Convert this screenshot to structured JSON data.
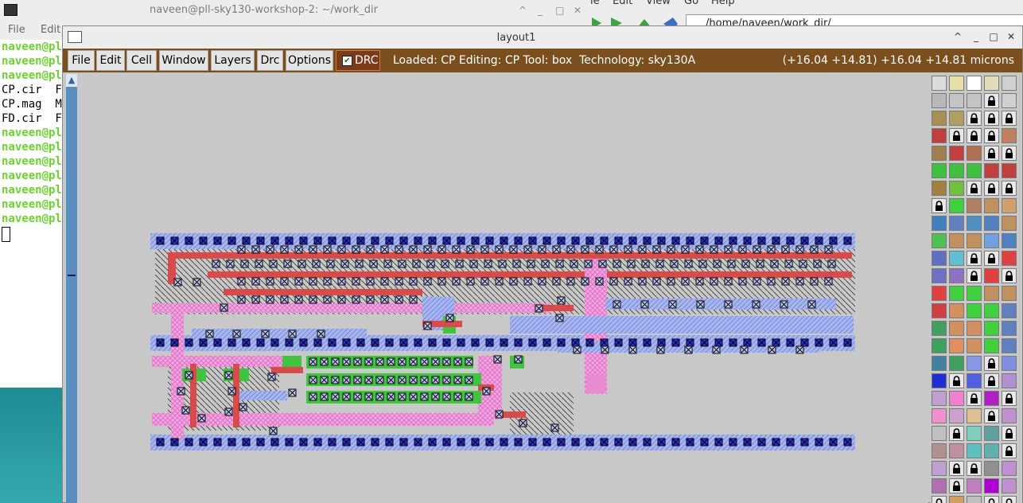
{
  "terminal": {
    "title": "naveen@pll-sky130-workshop-2: ~/work_dir",
    "menu": [
      "File",
      "Edit"
    ],
    "lines": [
      {
        "text": "naveen@pl",
        "prompt": true
      },
      {
        "text": "naveen@pl",
        "prompt": true
      },
      {
        "text": "naveen@pl",
        "prompt": true
      },
      {
        "text": "CP.cir  F",
        "prompt": false
      },
      {
        "text": "CP.mag  M",
        "prompt": false
      },
      {
        "text": "FD.cir  F",
        "prompt": false
      },
      {
        "text": "naveen@pl",
        "prompt": true
      },
      {
        "text": "naveen@pl",
        "prompt": true
      },
      {
        "text": "naveen@pl",
        "prompt": true
      },
      {
        "text": "naveen@pl",
        "prompt": true
      },
      {
        "text": "naveen@pl",
        "prompt": true
      },
      {
        "text": "naveen@pl",
        "prompt": true
      },
      {
        "text": "naveen@pl",
        "prompt": true
      }
    ]
  },
  "file_manager": {
    "menu": [
      "le",
      "Edit",
      "View",
      "Go",
      "Help"
    ],
    "path": "/home/naveen/work_dir/"
  },
  "layout_window": {
    "title": "layout1",
    "menu": [
      "File",
      "Edit",
      "Cell",
      "Window",
      "Layers",
      "Drc",
      "Options"
    ],
    "drc_label": "DRC",
    "drc_checked": true,
    "status": "Loaded: CP Editing: CP Tool: box  Technology: sky130A",
    "coordinates": "(+16.04 +14.81) +16.04 +14.81 microns"
  },
  "colors": {
    "menubar": "#7b4e1d",
    "metal1": "#8f9bff",
    "poly": "#d94a4a",
    "diffusion": "#3fc43f",
    "li": "#e88ad0",
    "via": "#2e2edc"
  },
  "palette": {
    "columns": 5,
    "rows": 25,
    "cells": [
      "#dcdcdc",
      "#e8e0a8",
      "#ffffff",
      "#e2dcb8",
      "#d0d0d0",
      "#b8b8b8",
      "#c4c4c4",
      "#c4c4c4",
      "lock",
      "#d0d0d0",
      "#a89050",
      "#b0a060",
      "lock",
      "lock",
      "lock",
      "#c04040",
      "lock",
      "lock",
      "lock",
      "#c08060",
      "#a08050",
      "#c04040",
      "#b07050",
      "lock",
      "lock",
      "#40c040",
      "#40c040",
      "#40c040",
      "#c04040",
      "#c04040",
      "#a08040",
      "#70c040",
      "lock",
      "lock",
      "lock",
      "lock",
      "#40d040",
      "#b08060",
      "#c09060",
      "#d0a070",
      "#4080c0",
      "#6080c0",
      "#5090c0",
      "#5080c0",
      "#c09060",
      "#50c050",
      "#c09060",
      "#c09060",
      "#70a0e0",
      "#5080c0",
      "#6070c0",
      "#60c0d0",
      "lock",
      "lock",
      "#e04040",
      "#7070c0",
      "#9070c0",
      "lock",
      "#e04040",
      "lock",
      "#e04040",
      "#40d040",
      "#40d040",
      "#c09060",
      "#c09060",
      "#d04040",
      "#d09060",
      "#40d040",
      "#40d040",
      "#6080c0",
      "#40a060",
      "#d09060",
      "#d09060",
      "#40d040",
      "#6080c0",
      "#40a060",
      "#e09060",
      "#d09060",
      "#40d040",
      "#6080c0",
      "#4080a0",
      "#40a060",
      "#8898e8",
      "lock",
      "#8090e0",
      "#2030d0",
      "lock",
      "#5060e0",
      "lock",
      "#b090d0",
      "#c0a0d0",
      "#f080d0",
      "lock",
      "#b020c0",
      "lock",
      "#f090d0",
      "#d0a0d0",
      "#e0c090",
      "lock",
      "#c090d0",
      "#c0c0c0",
      "lock",
      "#80d0c0",
      "#60a0a0",
      "lock",
      "#b09090",
      "#c090a0",
      "#60c0c0",
      "#60b0b0",
      "lock",
      "#c0a0d0",
      "lock",
      "lock",
      "#909090",
      "#c090d0",
      "#b070b0",
      "lock",
      "#c080c0",
      "#b000d0",
      "#c090d0",
      "lock",
      "#d0a060",
      "#c0c0c0",
      "lock",
      "lock"
    ]
  }
}
